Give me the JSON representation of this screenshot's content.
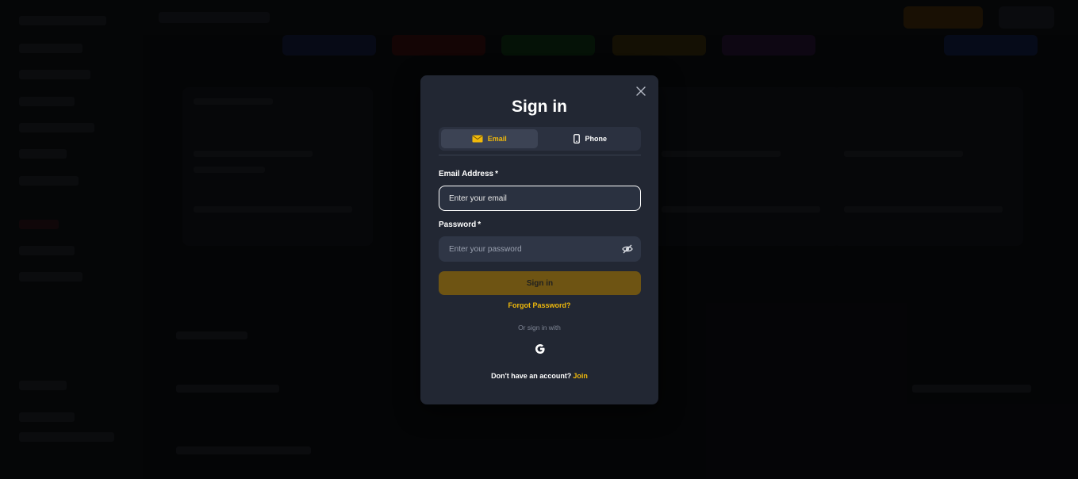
{
  "modal": {
    "title": "Sign in",
    "tabs": [
      {
        "label": "Email",
        "icon": "envelope-icon",
        "active": true
      },
      {
        "label": "Phone",
        "icon": "phone-icon",
        "active": false
      }
    ],
    "email": {
      "label": "Email Address",
      "required_mark": "*",
      "placeholder": "Enter your email",
      "value": ""
    },
    "password": {
      "label": "Password",
      "required_mark": "*",
      "placeholder": "Enter your password",
      "value": ""
    },
    "submit_label": "Sign in",
    "forgot_label": "Forgot Password?",
    "social_text": "Or sign in with",
    "no_account_text": "Don't have an account?",
    "join_label": "Join"
  },
  "colors": {
    "accent": "#f0b90b",
    "modal_bg": "#222733",
    "input_bg": "#2f3646",
    "submit_bg": "#6e5413",
    "backdrop": "#0b0c0f"
  }
}
